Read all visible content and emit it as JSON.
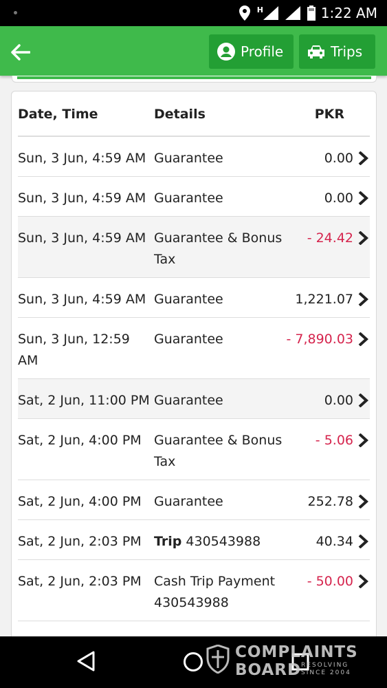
{
  "status_bar": {
    "time": "1:22 AM",
    "network_letter": "H"
  },
  "app_bar": {
    "profile_label": "Profile",
    "trips_label": "Trips"
  },
  "table": {
    "headers": {
      "date": "Date, Time",
      "details": "Details",
      "amount": "PKR"
    },
    "rows": [
      {
        "date": "Sun, 3 Jun, 4:59 AM",
        "bold": "",
        "details": "Guarantee",
        "amount": "0.00",
        "negative": false
      },
      {
        "date": "Sun, 3 Jun, 4:59 AM",
        "bold": "",
        "details": "Guarantee",
        "amount": "0.00",
        "negative": false
      },
      {
        "date": "Sun, 3 Jun, 4:59 AM",
        "bold": "",
        "details": "Guarantee & Bonus Tax",
        "amount": "- 24.42",
        "negative": true
      },
      {
        "date": "Sun, 3 Jun, 4:59 AM",
        "bold": "",
        "details": "Guarantee",
        "amount": "1,221.07",
        "negative": false
      },
      {
        "date": "Sun, 3 Jun, 12:59 AM",
        "bold": "",
        "details": "Guarantee",
        "amount": "- 7,890.03",
        "negative": true
      },
      {
        "date": "Sat, 2 Jun, 11:00 PM",
        "bold": "",
        "details": "Guarantee",
        "amount": "0.00",
        "negative": false
      },
      {
        "date": "Sat, 2 Jun, 4:00 PM",
        "bold": "",
        "details": "Guarantee & Bonus Tax",
        "amount": "- 5.06",
        "negative": true
      },
      {
        "date": "Sat, 2 Jun, 4:00 PM",
        "bold": "",
        "details": "Guarantee",
        "amount": "252.78",
        "negative": false
      },
      {
        "date": "Sat, 2 Jun, 2:03 PM",
        "bold": "Trip",
        "details": " 430543988",
        "amount": "40.34",
        "negative": false
      },
      {
        "date": "Sat, 2 Jun, 2:03 PM",
        "bold": "",
        "details": "Cash Trip Payment 430543988",
        "amount": "- 50.00",
        "negative": true
      }
    ]
  },
  "watermark": {
    "line1": "COMPLAINTS",
    "line2": "BOARD",
    "tag1": "RESOLVING",
    "tag2": "SINCE 2004"
  },
  "colors": {
    "brand_green": "#3fba4b",
    "button_green": "#239f34",
    "negative_red": "#d5244d"
  },
  "icons": [
    "signal-dot-icon",
    "location-pin-icon",
    "signal-strength-icon",
    "battery-icon",
    "back-arrow-icon",
    "user-circle-icon",
    "taxi-icon",
    "chevron-right-icon",
    "nav-back-icon",
    "nav-home-icon",
    "nav-recent-icon",
    "shield-logo-icon"
  ]
}
